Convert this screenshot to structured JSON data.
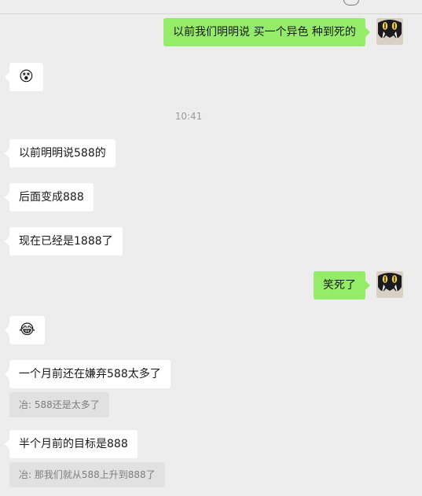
{
  "messages": {
    "m1": "以前我们明明说 买一个异色 种到死的",
    "m2": "😵",
    "time": "10:41",
    "m3": "以前明明说588的",
    "m4": "后面变成888",
    "m5": "现在已经是1888了",
    "m6": "笑死了",
    "m7": "😂",
    "m8": "一个月前还在嫌弃588太多了",
    "quote1": "冶: 588还是太多了",
    "m9": "半个月前的目标是888",
    "quote2": "冶: 那我们就从588上升到888了"
  },
  "colors": {
    "background": "#ededed",
    "incoming_bubble": "#ffffff",
    "outgoing_bubble": "#95ec69",
    "quote_bubble": "#e1e1e1"
  },
  "icons": {
    "top_chat_icon": "chat-bubble-icon",
    "avatar": "cartoon-avatar-icon"
  }
}
